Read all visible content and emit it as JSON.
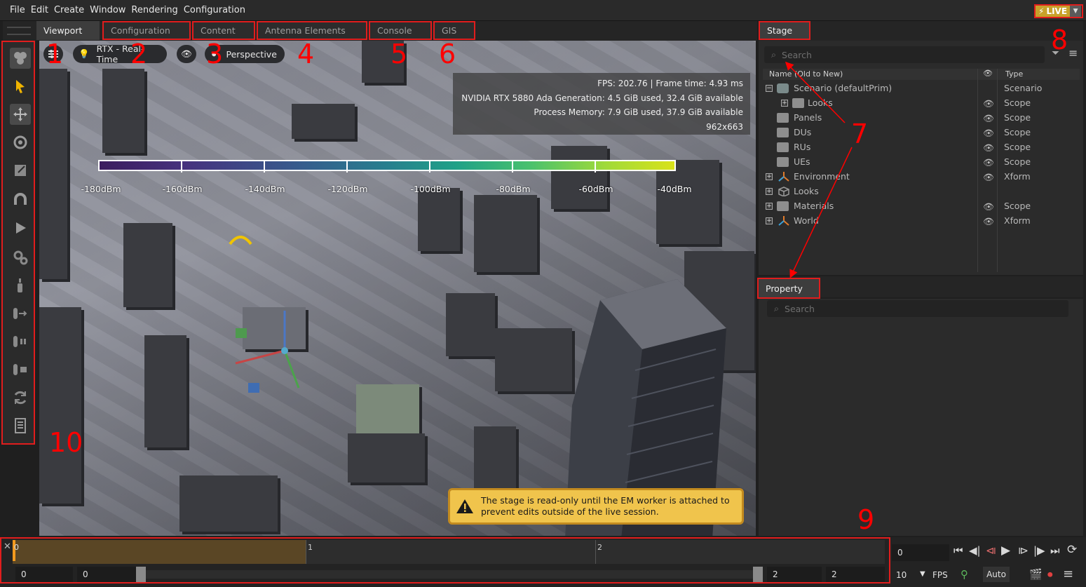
{
  "menu": [
    "File",
    "Edit",
    "Create",
    "Window",
    "Rendering",
    "Configuration"
  ],
  "live": {
    "label": "LIVE",
    "accent": "#c8a12a"
  },
  "tabs": {
    "viewport": "Viewport",
    "configuration": "Configuration",
    "content": "Content",
    "antenna": "Antenna Elements",
    "console": "Console",
    "gis": "GIS"
  },
  "callouts": [
    "1",
    "2",
    "3",
    "4",
    "5",
    "6",
    "7",
    "8",
    "9",
    "10"
  ],
  "viewport": {
    "renderer": "RTX - Real-Time",
    "camera": "Perspective",
    "stats": [
      "FPS: 202.76 | Frame time: 4.93 ms",
      "NVIDIA RTX 5880 Ada Generation: 4.5 GiB used, 32.4 GiB available",
      "Process Memory: 7.9 GiB used, 37.9 GiB available",
      "962x663"
    ],
    "legend": [
      "-180dBm",
      "-160dBm",
      "-140dBm",
      "-120dBm",
      "-100dBm",
      "-80dBm",
      "-60dBm",
      "-40dBm"
    ],
    "warning": "The stage is read-only until the EM worker is attached to prevent edits outside of the live session."
  },
  "stage": {
    "title": "Stage",
    "search_placeholder": "Search",
    "col_name": "Name (Old to New)",
    "col_type": "Type",
    "rows": [
      {
        "name": "Scenario (defaultPrim)",
        "type": "Scenario"
      },
      {
        "name": "Looks",
        "type": "Scope"
      },
      {
        "name": "Panels",
        "type": "Scope"
      },
      {
        "name": "DUs",
        "type": "Scope"
      },
      {
        "name": "RUs",
        "type": "Scope"
      },
      {
        "name": "UEs",
        "type": "Scope"
      },
      {
        "name": "Environment",
        "type": "Xform"
      },
      {
        "name": "Looks",
        "type": ""
      },
      {
        "name": "Materials",
        "type": "Scope"
      },
      {
        "name": "World",
        "type": "Xform"
      }
    ]
  },
  "property": {
    "title": "Property",
    "search_placeholder": "Search"
  },
  "timeline": {
    "ticks": [
      "0",
      "1",
      "2"
    ],
    "start": "0",
    "range_start": "0",
    "range_end": "2",
    "end": "2",
    "current_frame": "0",
    "fps_value": "10",
    "fps_label": "FPS",
    "auto_label": "Auto"
  },
  "colors": {
    "annotation": "#e11d1d",
    "warning_bg": "#f0c44c",
    "timeline_fill": "#5a4625"
  }
}
